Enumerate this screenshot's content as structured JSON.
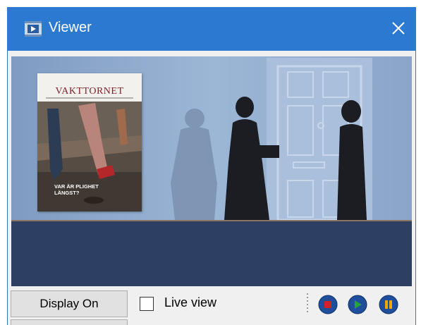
{
  "window": {
    "title": "Viewer",
    "title_icon": "video-frame-icon",
    "close_icon": "close-icon"
  },
  "viewer": {
    "magazine_masthead": "VAKTTORNET",
    "magazine_headline": "VAR ÄR PLIGHET LÄNGST?"
  },
  "toolbar": {
    "display_button_label": "Display On",
    "live_view_label": "Live view",
    "live_view_checked": false,
    "controls": [
      "stop-icon",
      "play-icon",
      "pause-icon"
    ]
  },
  "colors": {
    "titlebar": "#2b79d0",
    "viewer_bg": "#8fa9c9",
    "lower_band": "#2d4063",
    "media_button": "#1f4e9c",
    "stop": "#d4202a",
    "play": "#29a03a",
    "pause": "#f0a800"
  }
}
